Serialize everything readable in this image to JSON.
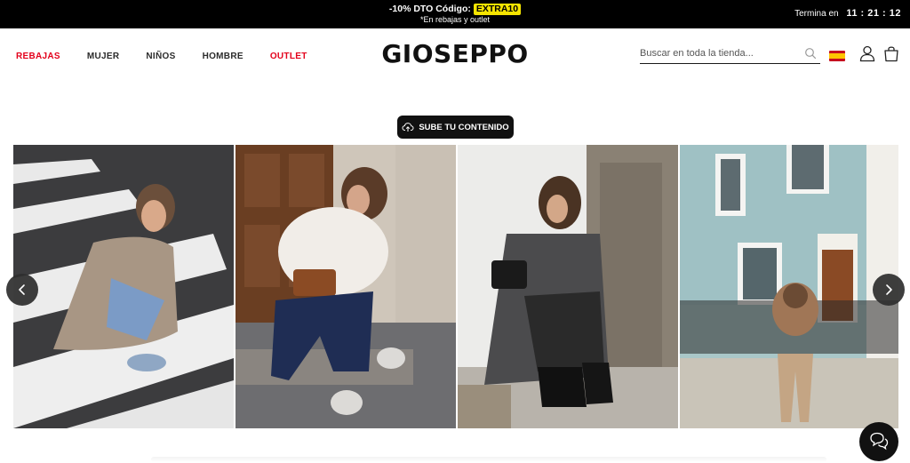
{
  "promo": {
    "line1_prefix": "-10% DTO Código:",
    "code": "EXTRA10",
    "line2": "*En rebajas y outlet",
    "timer_label": "Termina en",
    "timer_value": "11 : 21 : 12"
  },
  "header": {
    "nav": [
      {
        "label": "REBAJAS",
        "highlight": true
      },
      {
        "label": "MUJER",
        "highlight": false
      },
      {
        "label": "NIÑOS",
        "highlight": false
      },
      {
        "label": "HOMBRE",
        "highlight": false
      },
      {
        "label": "OUTLET",
        "highlight": true
      }
    ],
    "logo": "GIOSEPPO",
    "search_placeholder": "Buscar en toda la tienda...",
    "icons": [
      "search-icon",
      "spain-flag-icon",
      "user-icon",
      "cart-icon"
    ]
  },
  "ugc": {
    "upload_label": "SUBE TU CONTENIDO"
  },
  "colors": {
    "accent_red": "#e3001b",
    "promo_bg": "#000000",
    "code_bg": "#f5e400"
  }
}
